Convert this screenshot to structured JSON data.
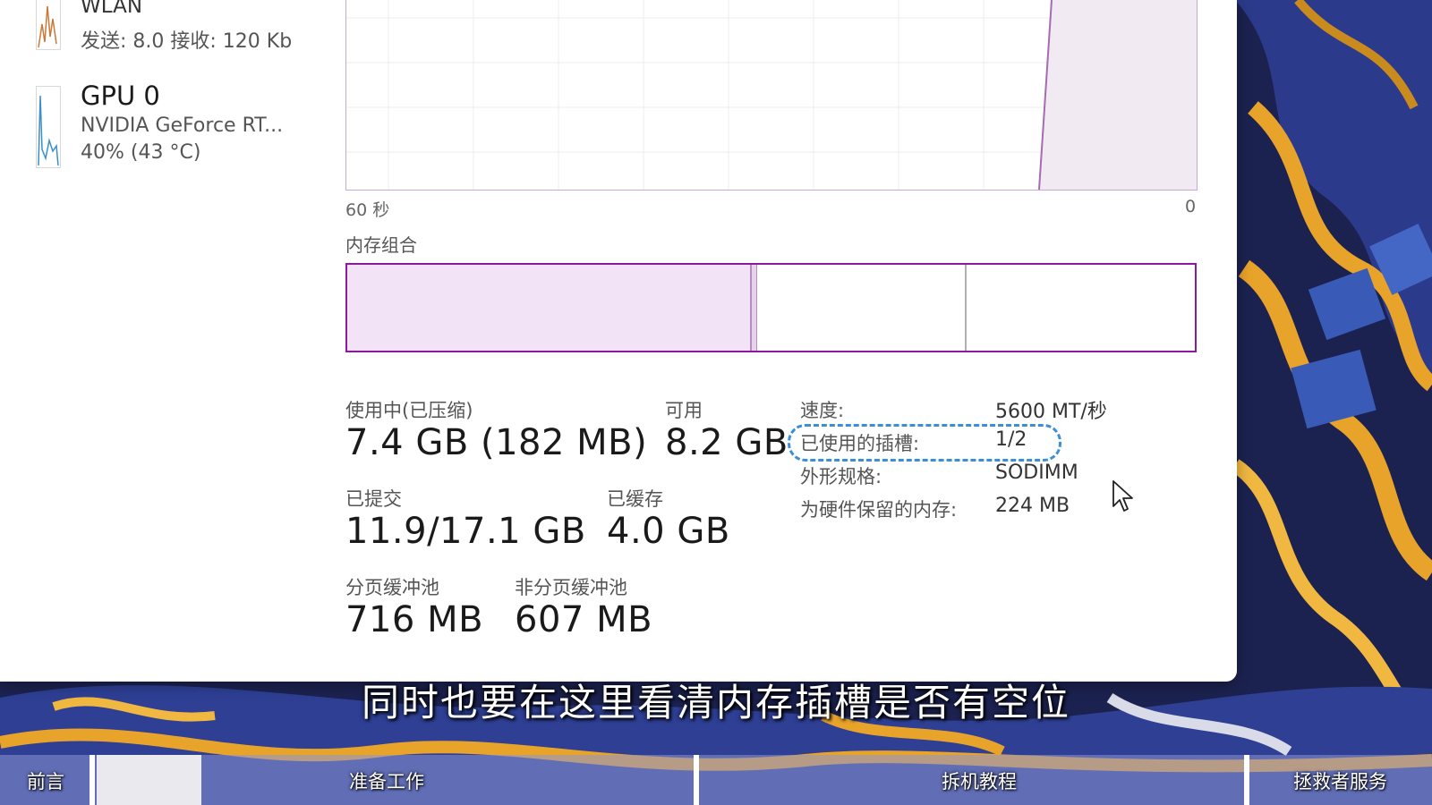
{
  "sidebar": {
    "items": [
      {
        "name": "WLAN",
        "detail": "发送: 8.0 接收: 120 Kb"
      },
      {
        "name": "GPU 0",
        "detail": "NVIDIA GeForce RT...",
        "extra": "40% (43 °C)"
      }
    ]
  },
  "graph": {
    "left_time": "60 秒",
    "right_time": "0"
  },
  "composition": {
    "label": "内存组合"
  },
  "stats": {
    "in_use_label": "使用中(已压缩)",
    "in_use_value": "7.4 GB (182 MB)",
    "available_label": "可用",
    "available_value": "8.2 GB",
    "committed_label": "已提交",
    "committed_value": "11.9/17.1 GB",
    "cached_label": "已缓存",
    "cached_value": "4.0 GB",
    "paged_label": "分页缓冲池",
    "paged_value": "716 MB",
    "nonpaged_label": "非分页缓冲池",
    "nonpaged_value": "607 MB"
  },
  "properties": {
    "speed_label": "速度:",
    "speed_value": "5600 MT/秒",
    "slots_label": "已使用的插槽:",
    "slots_value": "1/2",
    "form_label": "外形规格:",
    "form_value": "SODIMM",
    "reserved_label": "为硬件保留的内存:",
    "reserved_value": "224 MB"
  },
  "subtitle": "同时也要在这里看清内存插槽是否有空位",
  "chapters": [
    "前言",
    "准备工作",
    "拆机教程",
    "拯救者服务"
  ],
  "colors": {
    "memory_accent": "#8b1a9e",
    "memory_fill": "#f3e3f6",
    "highlight": "#3b8fd8",
    "wallpaper_bg": "#1c2250",
    "wallpaper_gold": "#e8a32a"
  }
}
